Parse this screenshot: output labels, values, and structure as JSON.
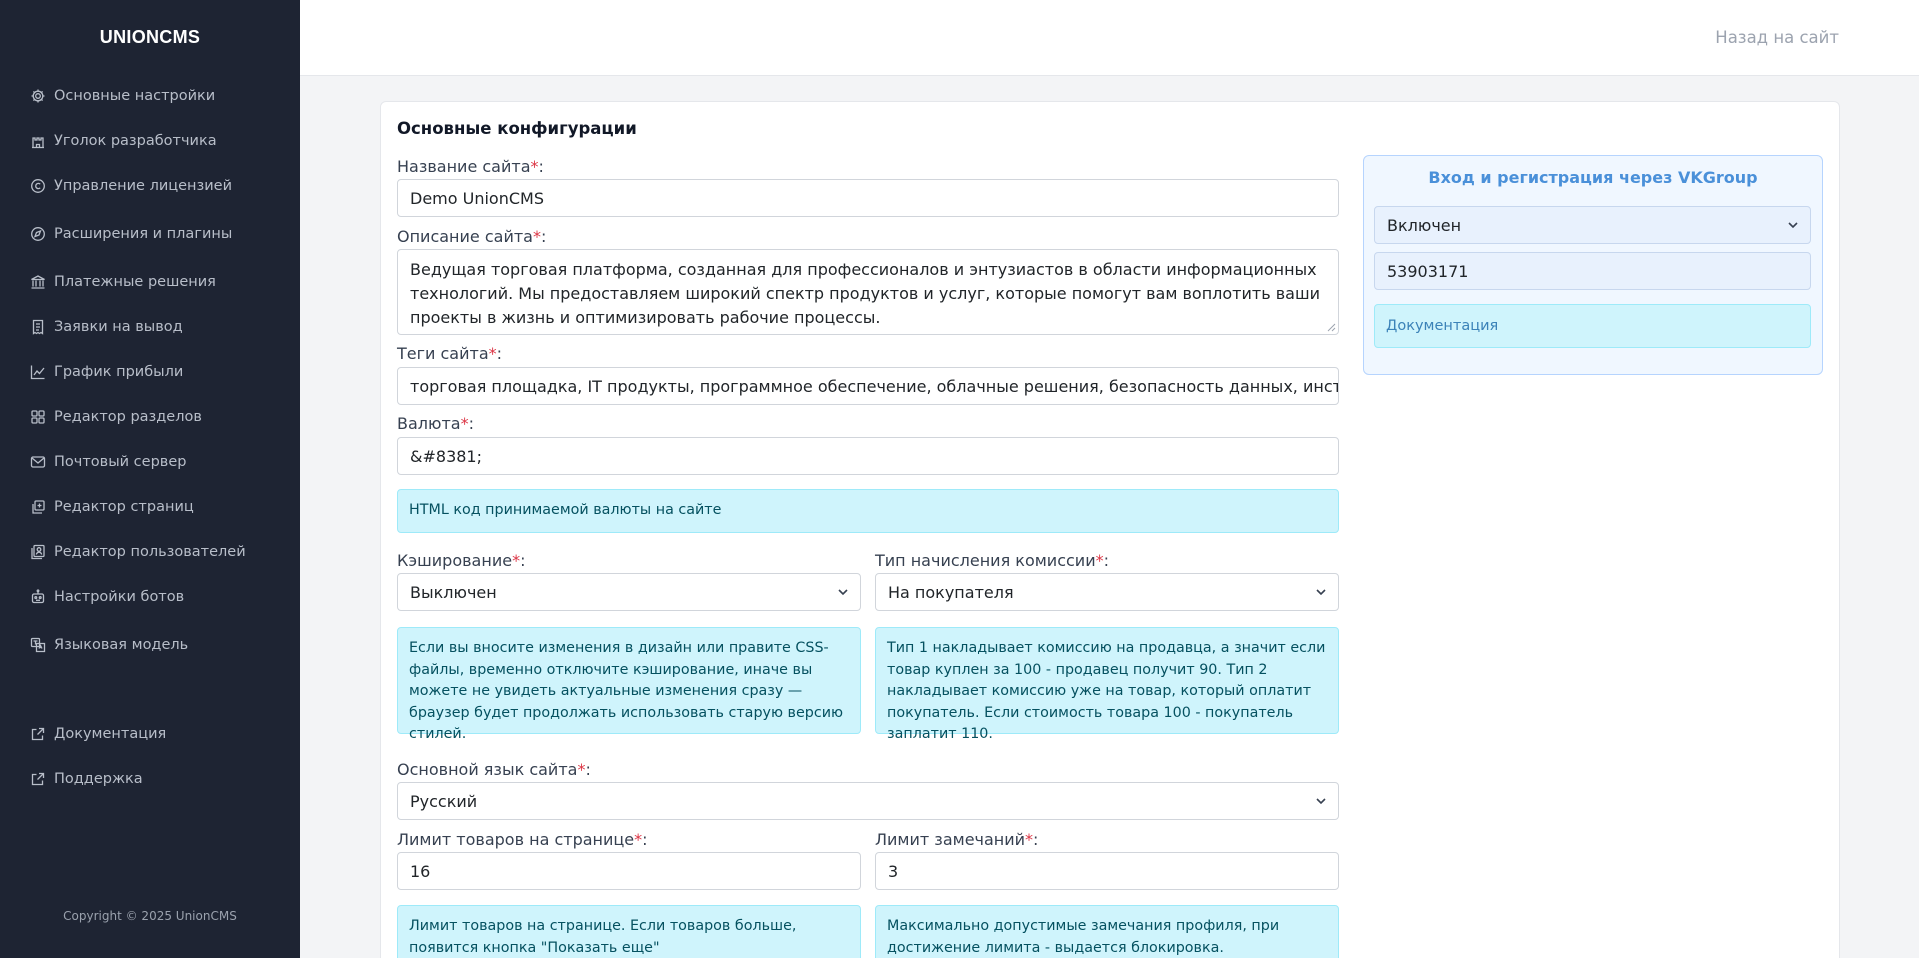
{
  "app": {
    "logo": "UNIONCMS",
    "copyright": "Copyright © 2025 UnionCMS"
  },
  "topbar": {
    "back_link": "Назад на сайт"
  },
  "sidebar": {
    "items": [
      {
        "label": "Основные настройки",
        "icon": "gear-icon"
      },
      {
        "label": "Уголок разработчика",
        "icon": "castle-icon"
      },
      {
        "label": "Управление лицензией",
        "icon": "copyright-icon"
      },
      {
        "label": "Расширения и плагины",
        "icon": "puzzle-icon"
      },
      {
        "label": "Платежные решения",
        "icon": "bank-icon"
      },
      {
        "label": "Заявки на вывод",
        "icon": "receipt-icon"
      },
      {
        "label": "График прибыли",
        "icon": "chart-icon"
      },
      {
        "label": "Редактор разделов",
        "icon": "grid-icon"
      },
      {
        "label": "Почтовый сервер",
        "icon": "mail-icon"
      },
      {
        "label": "Редактор страниц",
        "icon": "pages-icon"
      },
      {
        "label": "Редактор пользователей",
        "icon": "user-card-icon"
      },
      {
        "label": "Настройки ботов",
        "icon": "robot-icon"
      },
      {
        "label": "Языковая модель",
        "icon": "language-icon"
      }
    ],
    "links": [
      {
        "label": "Документация",
        "icon": "external-link-icon"
      },
      {
        "label": "Поддержка",
        "icon": "external-link-icon"
      }
    ]
  },
  "main": {
    "title": "Основные конфигурации",
    "required_mark": "*",
    "label_suffix": ":",
    "site_name": {
      "label": "Название сайта",
      "value": "Demo UnionCMS"
    },
    "site_description": {
      "label": "Описание сайта",
      "value": "Ведущая торговая платформа, созданная для профессионалов и энтузиастов в области информационных технологий. Мы предоставляем широкий спектр продуктов и услуг, которые помогут вам воплотить ваши проекты в жизнь и оптимизировать рабочие процессы."
    },
    "site_tags": {
      "label": "Теги сайта",
      "value": "торговая площадка, IT продукты, программное обеспечение, облачные решения, безопасность данных, инструмен"
    },
    "currency": {
      "label": "Валюта",
      "value": "&#8381;",
      "info": "HTML код принимаемой валюты на сайте"
    },
    "caching": {
      "label": "Кэширование",
      "value": "Выключен",
      "info": "Если вы вносите изменения в дизайн или правите CSS-файлы, временно отключите кэширование, иначе вы можете не увидеть актуальные изменения сразу — браузер будет продолжать использовать старую версию стилей."
    },
    "commission": {
      "label": "Тип начисления комиссии",
      "value": "На покупателя",
      "info": "Тип 1 накладывает комиссию на продавца, а значит если товар куплен за 100 - продавец получит 90. Тип 2 накладывает комиссию уже на товар, который оплатит покупатель. Если стоимость товара 100 - покупатель заплатит 110."
    },
    "language": {
      "label": "Основной язык сайта",
      "value": "Русский"
    },
    "products_limit": {
      "label": "Лимит товаров на странице",
      "value": "16",
      "info": "Лимит товаров на странице. Если товаров больше, появится кнопка \"Показать еще\""
    },
    "warnings_limit": {
      "label": "Лимит замечаний",
      "value": "3",
      "info": "Максимально допустимые замечания профиля, при достижение лимита - выдается блокировка."
    }
  },
  "vk": {
    "title": "Вход и регистрация через VKGroup",
    "status": "Включен",
    "group_id": "53903171",
    "doc_link": "Документация"
  }
}
